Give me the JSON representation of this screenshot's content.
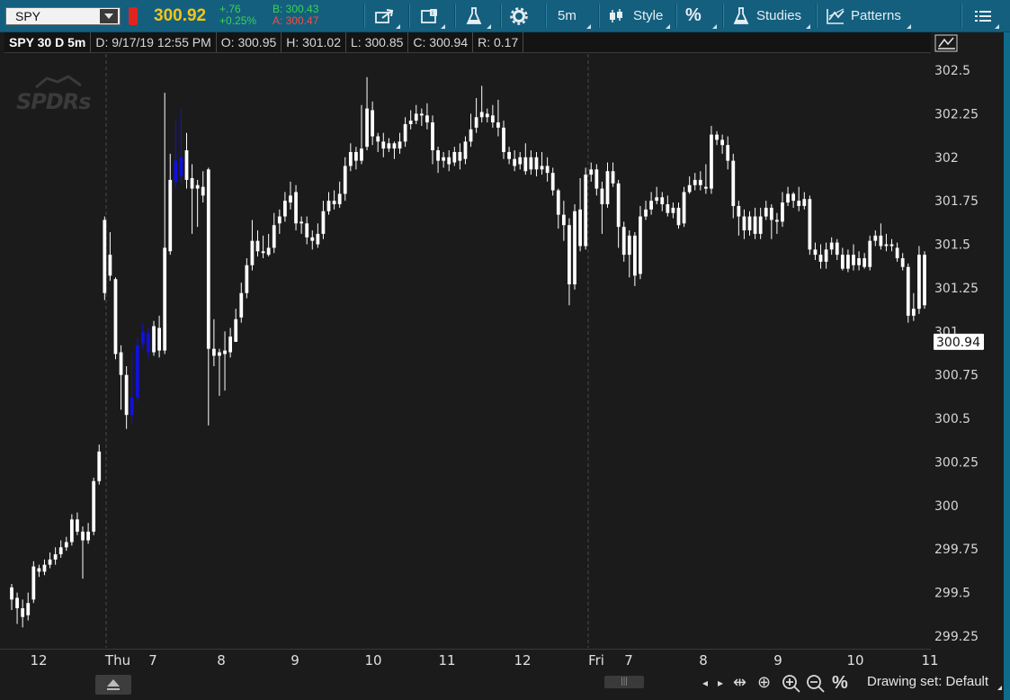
{
  "toolbar": {
    "symbol": "SPY",
    "last": "300.92",
    "net_change": "+.76",
    "pct_change": "+0.25%",
    "bid": "B: 300.43",
    "ask": "A: 300.47",
    "timeframe": "5m",
    "style": "Style",
    "percent": "%",
    "studies": "Studies",
    "patterns": "Patterns",
    "icons": [
      "share-icon",
      "calendar-icon",
      "flask-icon",
      "gear-icon",
      "candle-icon",
      "menu-icon"
    ]
  },
  "status": {
    "title": "SPY 30 D 5m",
    "date": "D: 9/17/19 12:55 PM",
    "open": "O: 300.95",
    "high": "H: 301.02",
    "low": "L: 300.85",
    "close": "C: 300.94",
    "range": "R: 0.17"
  },
  "watermark": "SPDRs",
  "colors": {
    "background": "#1b1b1b",
    "up": "#ffffff",
    "down": "#ffffff",
    "highlight": "#1010e0",
    "toolbar": "#145f7e",
    "last": "#f5c518"
  },
  "bottom": {
    "drawing_set": "Drawing set: Default",
    "percent": "%"
  },
  "chart_data": {
    "type": "candlestick",
    "y_ticks": [
      "302.5",
      "302.25",
      "302",
      "301.75",
      "301.5",
      "301.25",
      "301",
      "300.75",
      "300.5",
      "300.25",
      "300",
      "299.75",
      "299.5",
      "299.25"
    ],
    "x_ticks": [
      "12",
      "Thu",
      "7",
      "8",
      "9",
      "10",
      "11",
      "12",
      "Fri",
      "7",
      "8",
      "9",
      "10",
      "11"
    ],
    "ylim": [
      299.22,
      302.7
    ],
    "current_price": "300.94",
    "day_separators": [
      "Thu",
      "Fri"
    ],
    "grid": false,
    "candles": [
      [
        299.53,
        299.46,
        299.55,
        299.4
      ],
      [
        299.47,
        299.41,
        299.5,
        299.32
      ],
      [
        299.41,
        299.36,
        299.46,
        299.3
      ],
      [
        299.37,
        299.44,
        299.5,
        299.34
      ],
      [
        299.46,
        299.65,
        299.68,
        299.44
      ],
      [
        299.64,
        299.62,
        299.66,
        299.59
      ],
      [
        299.62,
        299.66,
        299.69,
        299.6
      ],
      [
        299.66,
        299.69,
        299.73,
        299.64
      ],
      [
        299.69,
        299.72,
        299.76,
        299.66
      ],
      [
        299.72,
        299.76,
        299.8,
        299.7
      ],
      [
        299.76,
        299.79,
        299.82,
        299.74
      ],
      [
        299.79,
        299.92,
        299.95,
        299.77
      ],
      [
        299.92,
        299.85,
        299.96,
        299.83
      ],
      [
        299.85,
        299.8,
        299.88,
        299.58
      ],
      [
        299.8,
        299.85,
        299.9,
        299.78
      ],
      [
        299.85,
        300.14,
        300.16,
        299.83
      ],
      [
        300.14,
        300.31,
        300.35,
        300.12
      ],
      [
        301.64,
        301.22,
        301.66,
        301.18
      ],
      [
        301.44,
        301.32,
        301.57,
        301.29
      ],
      [
        301.3,
        300.87,
        301.31,
        300.84
      ],
      [
        300.88,
        300.75,
        300.92,
        300.55
      ],
      [
        300.75,
        300.52,
        300.8,
        300.44
      ],
      [
        300.52,
        300.62,
        300.88,
        300.47
      ],
      [
        300.62,
        300.92,
        300.96,
        300.6
      ],
      [
        300.93,
        301.0,
        301.05,
        300.9
      ],
      [
        300.99,
        300.88,
        301.02,
        300.85
      ],
      [
        300.88,
        301.03,
        301.06,
        300.86
      ],
      [
        301.02,
        300.89,
        301.09,
        300.85
      ],
      [
        300.89,
        301.48,
        302.37,
        300.87
      ],
      [
        301.46,
        301.87,
        302.02,
        301.44
      ],
      [
        301.86,
        301.98,
        302.22,
        301.82
      ],
      [
        302.0,
        301.89,
        302.28,
        301.85
      ],
      [
        302.04,
        301.87,
        302.14,
        301.82
      ],
      [
        301.88,
        301.82,
        301.96,
        301.56
      ],
      [
        301.82,
        301.84,
        301.87,
        301.6
      ],
      [
        301.83,
        301.78,
        301.92,
        301.74
      ],
      [
        301.93,
        300.9,
        301.94,
        300.46
      ],
      [
        300.9,
        300.86,
        301.07,
        300.8
      ],
      [
        300.86,
        300.88,
        300.9,
        300.63
      ],
      [
        300.89,
        300.87,
        301.0,
        300.66
      ],
      [
        300.88,
        300.97,
        301.02,
        300.85
      ],
      [
        300.94,
        301.07,
        301.13,
        301.02
      ],
      [
        301.08,
        301.22,
        301.28,
        301.05
      ],
      [
        301.22,
        301.38,
        301.42,
        301.19
      ],
      [
        301.38,
        301.52,
        301.64,
        301.35
      ],
      [
        301.52,
        301.46,
        301.58,
        301.43
      ],
      [
        301.46,
        301.45,
        301.55,
        301.42
      ],
      [
        301.44,
        301.48,
        301.56,
        301.43
      ],
      [
        301.48,
        301.61,
        301.68,
        301.45
      ],
      [
        301.62,
        301.66,
        301.7,
        301.56
      ],
      [
        301.66,
        301.75,
        301.8,
        301.63
      ],
      [
        301.74,
        301.78,
        301.86,
        301.7
      ],
      [
        301.8,
        301.62,
        301.84,
        301.58
      ],
      [
        301.62,
        301.63,
        301.66,
        301.56
      ],
      [
        301.62,
        301.54,
        301.66,
        301.5
      ],
      [
        301.54,
        301.52,
        301.58,
        301.47
      ],
      [
        301.5,
        301.56,
        301.62,
        301.48
      ],
      [
        301.56,
        301.69,
        301.75,
        301.53
      ],
      [
        301.69,
        301.75,
        301.8,
        301.67
      ],
      [
        301.75,
        301.73,
        301.81,
        301.7
      ],
      [
        301.73,
        301.79,
        301.86,
        301.71
      ],
      [
        301.79,
        301.95,
        302.0,
        301.75
      ],
      [
        301.95,
        302.03,
        302.08,
        301.92
      ],
      [
        302.03,
        301.98,
        302.06,
        301.93
      ],
      [
        301.98,
        302.05,
        302.3,
        301.96
      ],
      [
        302.06,
        302.28,
        302.46,
        302.04
      ],
      [
        302.27,
        302.12,
        302.32,
        302.07
      ],
      [
        302.12,
        302.09,
        302.14,
        302.03
      ],
      [
        302.09,
        302.05,
        302.14,
        302.0
      ],
      [
        302.05,
        302.08,
        302.11,
        302.03
      ],
      [
        302.08,
        302.05,
        302.09,
        301.99
      ],
      [
        302.05,
        302.09,
        302.14,
        302.02
      ],
      [
        302.09,
        302.19,
        302.23,
        302.06
      ],
      [
        302.19,
        302.21,
        302.27,
        302.16
      ],
      [
        302.21,
        302.25,
        302.3,
        302.19
      ],
      [
        302.25,
        302.24,
        302.28,
        302.18
      ],
      [
        302.24,
        302.2,
        302.31,
        302.16
      ],
      [
        302.2,
        302.04,
        302.24,
        301.96
      ],
      [
        302.04,
        301.98,
        302.06,
        301.91
      ],
      [
        301.98,
        302.0,
        302.03,
        301.94
      ],
      [
        302.0,
        301.96,
        302.04,
        301.92
      ],
      [
        301.97,
        302.03,
        302.06,
        301.95
      ],
      [
        302.03,
        301.98,
        302.08,
        301.93
      ],
      [
        301.99,
        302.09,
        302.12,
        301.96
      ],
      [
        302.09,
        302.16,
        302.25,
        302.06
      ],
      [
        302.17,
        302.23,
        302.34,
        302.14
      ],
      [
        302.23,
        302.26,
        302.41,
        302.2
      ],
      [
        302.25,
        302.23,
        302.28,
        302.2
      ],
      [
        302.24,
        302.2,
        302.3,
        302.17
      ],
      [
        302.2,
        302.17,
        302.33,
        302.12
      ],
      [
        302.17,
        302.03,
        302.21,
        301.99
      ],
      [
        302.03,
        301.99,
        302.06,
        301.96
      ],
      [
        301.99,
        301.95,
        302.04,
        301.92
      ],
      [
        301.96,
        302.0,
        302.03,
        301.93
      ],
      [
        302.0,
        301.92,
        302.08,
        301.9
      ],
      [
        301.93,
        302.0,
        302.04,
        301.9
      ],
      [
        302.0,
        301.93,
        302.03,
        301.89
      ],
      [
        301.93,
        301.95,
        302.03,
        301.9
      ],
      [
        301.95,
        301.91,
        302.0,
        301.86
      ],
      [
        301.91,
        301.81,
        301.94,
        301.78
      ],
      [
        301.81,
        301.67,
        301.82,
        301.59
      ],
      [
        301.67,
        301.61,
        301.75,
        301.52
      ],
      [
        301.61,
        301.27,
        301.65,
        301.15
      ],
      [
        301.27,
        301.69,
        301.73,
        301.24
      ],
      [
        301.7,
        301.49,
        301.88,
        301.46
      ],
      [
        301.49,
        301.9,
        301.94,
        301.47
      ],
      [
        301.9,
        301.93,
        301.97,
        301.86
      ],
      [
        301.93,
        301.82,
        301.96,
        301.78
      ],
      [
        301.82,
        301.73,
        301.86,
        301.56
      ],
      [
        301.73,
        301.92,
        301.97,
        301.71
      ],
      [
        301.92,
        301.85,
        301.97,
        301.83
      ],
      [
        301.85,
        301.6,
        301.87,
        301.48
      ],
      [
        301.6,
        301.44,
        301.63,
        301.4
      ],
      [
        301.44,
        301.55,
        301.58,
        301.31
      ],
      [
        301.55,
        301.32,
        301.57,
        301.26
      ],
      [
        301.33,
        301.66,
        301.72,
        301.3
      ],
      [
        301.66,
        301.7,
        301.75,
        301.64
      ],
      [
        301.7,
        301.75,
        301.8,
        301.67
      ],
      [
        301.75,
        301.77,
        301.83,
        301.73
      ],
      [
        301.77,
        301.73,
        301.8,
        301.69
      ],
      [
        301.73,
        301.68,
        301.78,
        301.66
      ],
      [
        301.68,
        301.71,
        301.74,
        301.65
      ],
      [
        301.71,
        301.61,
        301.74,
        301.59
      ],
      [
        301.62,
        301.8,
        301.83,
        301.6
      ],
      [
        301.8,
        301.84,
        301.89,
        301.79
      ],
      [
        301.84,
        301.87,
        301.91,
        301.81
      ],
      [
        301.87,
        301.84,
        301.92,
        301.81
      ],
      [
        301.83,
        301.82,
        301.96,
        301.79
      ],
      [
        301.82,
        302.13,
        302.18,
        301.79
      ],
      [
        302.13,
        302.1,
        302.15,
        302.07
      ],
      [
        302.1,
        302.07,
        302.13,
        302.02
      ],
      [
        302.07,
        301.98,
        302.12,
        301.93
      ],
      [
        301.98,
        301.72,
        302.02,
        301.65
      ],
      [
        301.72,
        301.66,
        301.75,
        301.55
      ],
      [
        301.66,
        301.58,
        301.7,
        301.53
      ],
      [
        301.58,
        301.66,
        301.69,
        301.55
      ],
      [
        301.66,
        301.56,
        301.71,
        301.53
      ],
      [
        301.56,
        301.66,
        301.71,
        301.53
      ],
      [
        301.66,
        301.71,
        301.75,
        301.64
      ],
      [
        301.71,
        301.64,
        301.73,
        301.53
      ],
      [
        301.64,
        301.63,
        301.68,
        301.56
      ],
      [
        301.63,
        301.74,
        301.8,
        301.6
      ],
      [
        301.74,
        301.79,
        301.83,
        301.72
      ],
      [
        301.79,
        301.75,
        301.8,
        301.71
      ],
      [
        301.75,
        301.72,
        301.83,
        301.69
      ],
      [
        301.72,
        301.76,
        301.8,
        301.7
      ],
      [
        301.76,
        301.47,
        301.78,
        301.44
      ],
      [
        301.47,
        301.44,
        301.51,
        301.41
      ],
      [
        301.44,
        301.4,
        301.5,
        301.36
      ],
      [
        301.4,
        301.47,
        301.51,
        301.36
      ],
      [
        301.47,
        301.51,
        301.54,
        301.44
      ],
      [
        301.51,
        301.44,
        301.53,
        301.41
      ],
      [
        301.44,
        301.36,
        301.48,
        301.35
      ],
      [
        301.36,
        301.44,
        301.47,
        301.34
      ],
      [
        301.44,
        301.38,
        301.5,
        301.35
      ],
      [
        301.38,
        301.42,
        301.46,
        301.35
      ],
      [
        301.42,
        301.37,
        301.45,
        301.36
      ],
      [
        301.37,
        301.52,
        301.55,
        301.35
      ],
      [
        301.52,
        301.55,
        301.58,
        301.49
      ],
      [
        301.55,
        301.49,
        301.62,
        301.47
      ],
      [
        301.49,
        301.5,
        301.56,
        301.46
      ],
      [
        301.5,
        301.49,
        301.53,
        301.46
      ],
      [
        301.48,
        301.42,
        301.51,
        301.4
      ],
      [
        301.42,
        301.37,
        301.45,
        301.35
      ],
      [
        301.37,
        301.09,
        301.39,
        301.05
      ],
      [
        301.09,
        301.13,
        301.22,
        301.06
      ],
      [
        301.13,
        301.44,
        301.49,
        301.1
      ],
      [
        301.44,
        301.15,
        301.46,
        301.13
      ]
    ],
    "highlight": [
      [
        22,
        25
      ],
      [
        30,
        31
      ]
    ]
  }
}
